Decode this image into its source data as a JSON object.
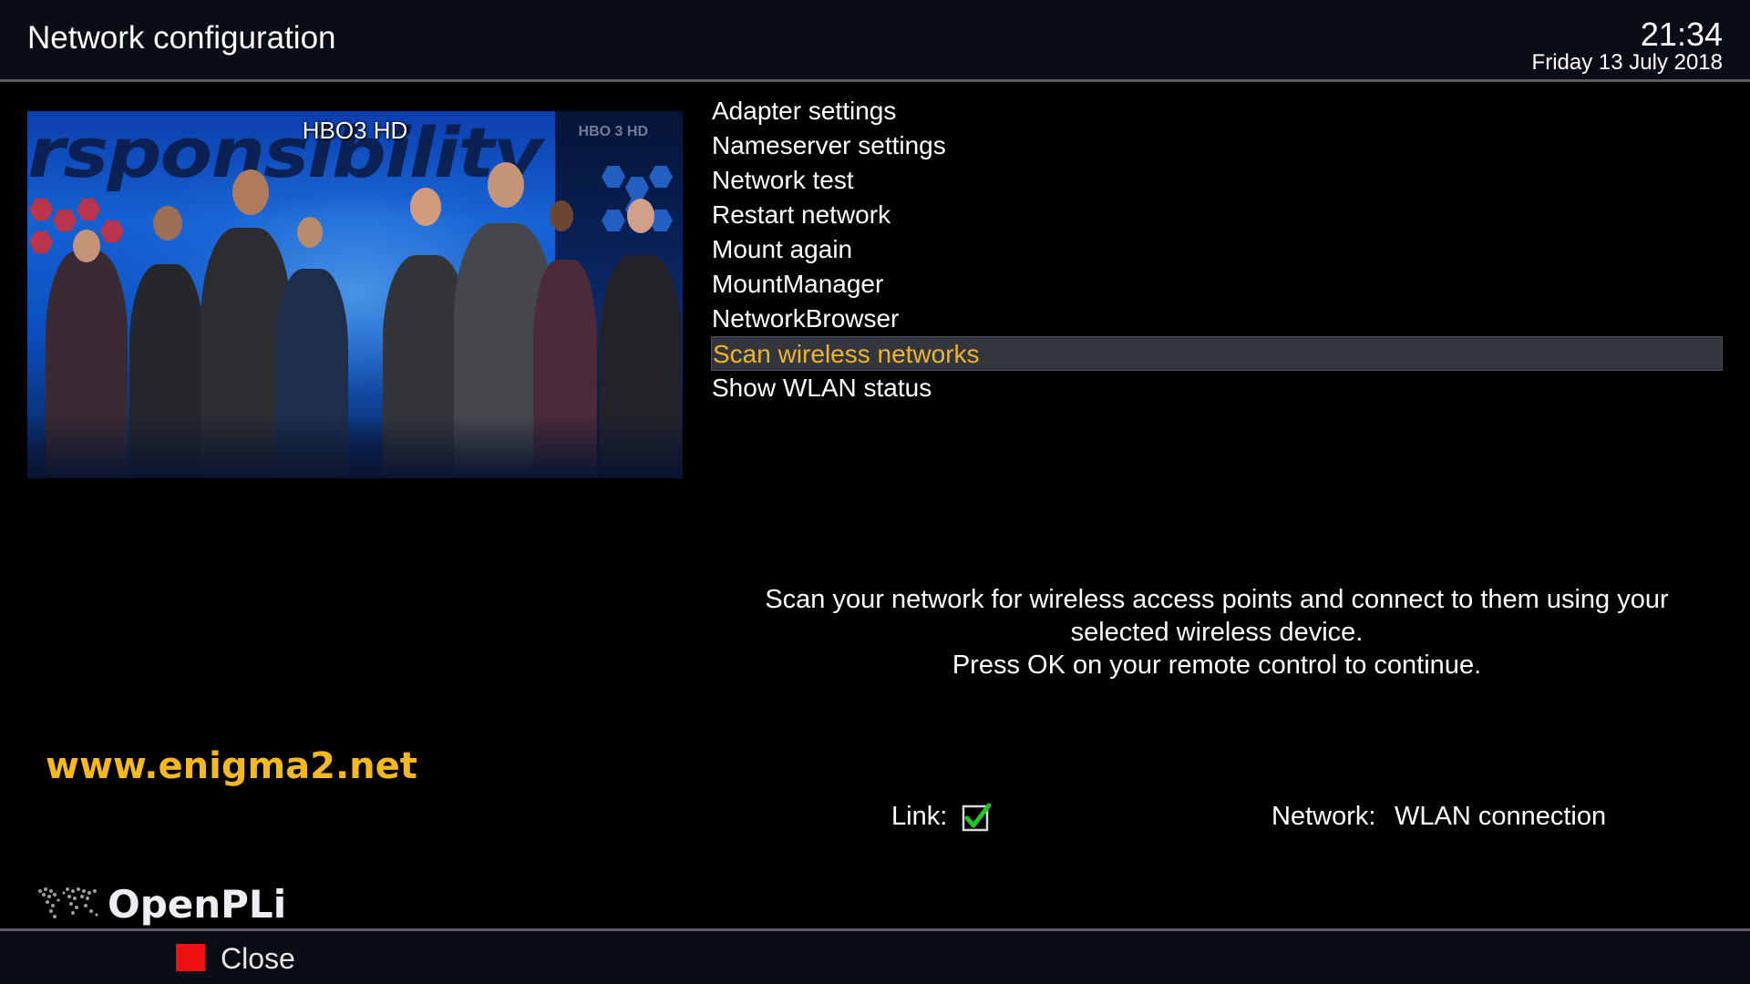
{
  "header": {
    "title": "Network configuration",
    "time": "21:34",
    "date": "Friday 13 July 2018"
  },
  "preview": {
    "channel_name": "HBO3 HD",
    "channel_logo": "HBO 3 HD",
    "banner_text": "rsponsibility"
  },
  "menu": {
    "items": [
      {
        "label": "Adapter settings",
        "selected": false
      },
      {
        "label": "Nameserver settings",
        "selected": false
      },
      {
        "label": "Network test",
        "selected": false
      },
      {
        "label": "Restart network",
        "selected": false
      },
      {
        "label": "Mount again",
        "selected": false
      },
      {
        "label": "MountManager",
        "selected": false
      },
      {
        "label": "NetworkBrowser",
        "selected": false
      },
      {
        "label": "Scan wireless networks",
        "selected": true
      },
      {
        "label": "Show WLAN status",
        "selected": false
      }
    ]
  },
  "description": {
    "line1": "Scan your network for wireless access points and connect to them using your",
    "line2": "selected wireless device.",
    "line3": "Press OK on your remote control to continue."
  },
  "watermark": "www.enigma2.net",
  "status": {
    "link_label": "Link:",
    "link_checked": true,
    "link_icon": "checkbox-checked-icon",
    "network_label": "Network:",
    "network_value": "WLAN connection"
  },
  "brand": {
    "name": "OpenPLi",
    "logo_icon": "world-map-icon"
  },
  "footer": {
    "red_key_icon": "red-key-icon",
    "close_label": "Close"
  },
  "colors": {
    "background": "#000000",
    "bar_background": "#0b0d16",
    "divider": "#5b5d63",
    "selection_background": "#34363d",
    "selected_text": "#f0b429",
    "watermark": "#f5b81d",
    "red_key": "#ee1111",
    "check_green": "#22c322"
  }
}
